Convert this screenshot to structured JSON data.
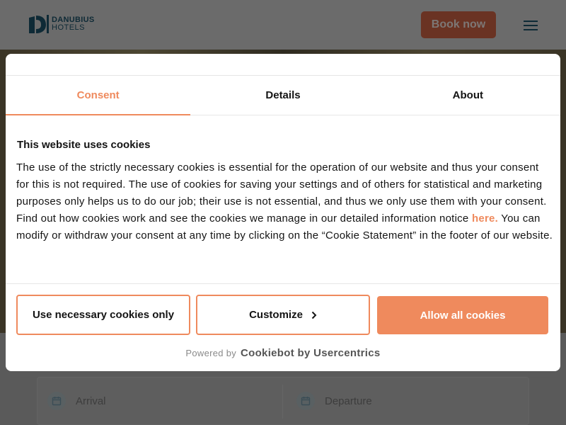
{
  "header": {
    "logo_line1": "DANUBIUS",
    "logo_line2": "HOTELS",
    "book_label": "Book now",
    "menu_icon": "hamburger-menu-icon"
  },
  "booking": {
    "arrival_placeholder": "Arrival",
    "departure_placeholder": "Departure",
    "calendar_icon": "calendar-icon"
  },
  "cookie": {
    "tabs": [
      {
        "label": "Consent",
        "active": true
      },
      {
        "label": "Details",
        "active": false
      },
      {
        "label": "About",
        "active": false
      }
    ],
    "title": "This website uses cookies",
    "body_before": "The use of the strictly necessary cookies is essential for the operation of our website and thus your consent for this is not required. The use of cookies for saving your settings and of others for statistical and marketing purposes only helps us to do our job; their use is not essential, and thus we only use them with your consent. Find out how cookies work and see the cookies we manage in our detailed information notice ",
    "link_text": "here.",
    "body_after": " You can modify or withdraw your consent at any time by clicking on the “Cookie Statement” in the footer of our website.",
    "buttons": {
      "necessary": "Use necessary cookies only",
      "customize": "Customize",
      "allow": "Allow all cookies"
    },
    "powered_by": "Powered by",
    "brand": "Cookiebot by Usercentrics"
  },
  "colors": {
    "accent": "#ef8a5d",
    "text": "#141414",
    "brand_dark": "#0e2a36"
  }
}
